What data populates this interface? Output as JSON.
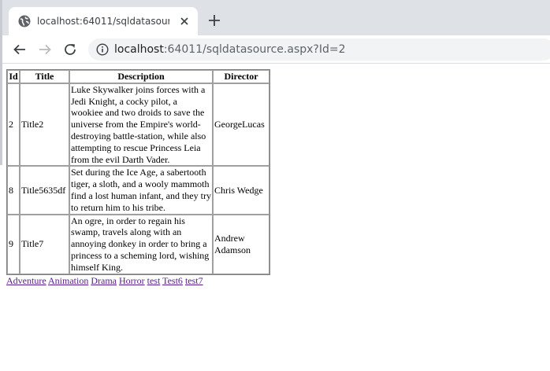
{
  "browser": {
    "tab_title": "localhost:64011/sqldatasource.aspx?Id=2",
    "url_host": "localhost",
    "url_rest": ":64011/sqldatasource.aspx?Id=2"
  },
  "table": {
    "headers": [
      "Id",
      "Title",
      "Description",
      "Director"
    ],
    "rows": [
      {
        "id": "2",
        "title": "Title2",
        "description": "Luke Skywalker joins forces with a Jedi Knight, a cocky pilot, a wookiee and two droids to save the universe from the Empire's world-destroying battle-station, while also attempting to rescue Princess Leia from the evil Darth Vader.",
        "director": "GeorgeLucas"
      },
      {
        "id": "8",
        "title": "Title5635df",
        "description": "Set during the Ice Age, a sabertooth tiger, a sloth, and a wooly mammoth find a lost human infant, and they try to return him to his tribe.",
        "director": "Chris Wedge"
      },
      {
        "id": "9",
        "title": "Title7",
        "description": "An ogre, in order to regain his swamp, travels along with an annoying donkey in order to bring a princess to a scheming lord, wishing himself King.",
        "director": "Andrew Adamson"
      }
    ]
  },
  "genre_links": [
    "Adventure",
    "Animation",
    "Drama",
    "Horror",
    "test",
    "Test6",
    "test7"
  ]
}
